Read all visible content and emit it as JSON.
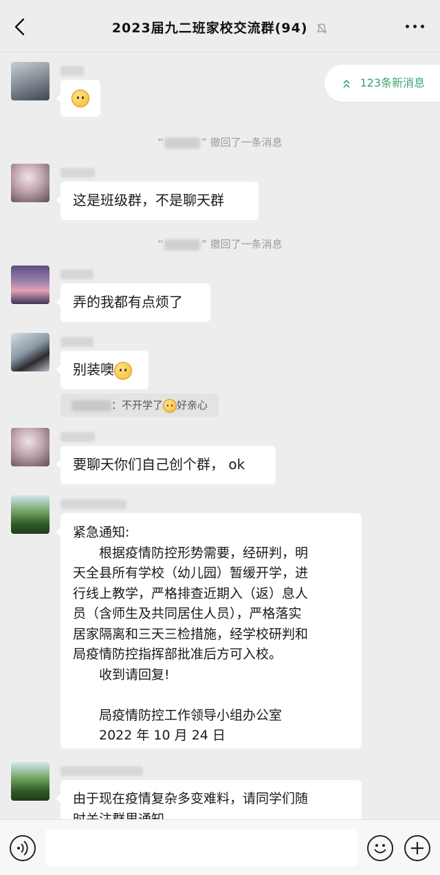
{
  "header": {
    "title": "2023届九二班家校交流群(94)"
  },
  "new_messages": {
    "label": "123条新消息"
  },
  "messages": [
    {
      "emoji": "face-emoji"
    },
    {
      "text": "这是班级群，不是聊天群"
    },
    {
      "text": "弄的我都有点烦了"
    },
    {
      "text": "别装噢"
    },
    {
      "text": "要聊天你们自己创个群， ok"
    },
    {
      "lines": [
        "紧急通知:",
        "　　根据疫情防控形势需要，经研判，明",
        "天全县所有学校（幼儿园）暂缓开学，进",
        "行线上教学，严格排查近期入（返）息人",
        "员（含师生及共同居住人员），严格落实",
        "居家隔离和三天三检措施，经学校研判和",
        "局疫情防控指挥部批准后方可入校。",
        "　　收到请回复!",
        "",
        "　　局疫情防控工作领导小组办公室",
        "　　2022 年 10 月 24 日"
      ]
    },
    {
      "lines": [
        "由于现在疫情复杂多变难料，请同学们随",
        "时关注群里通知"
      ]
    }
  ],
  "system": {
    "recall_suffix": "撤回了一条消息",
    "quote_text": "：不开学了",
    "quote_text_after": "好亲心"
  },
  "colors": {
    "accent": "#3ca372",
    "background": "#ededed",
    "bubble": "#ffffff"
  },
  "icons": {
    "back": "chevron-left-icon",
    "mute": "bell-muted-icon",
    "more": "ellipsis-icon",
    "voice": "voice-icon",
    "emoji": "smiley-icon",
    "plus": "plus-icon"
  }
}
